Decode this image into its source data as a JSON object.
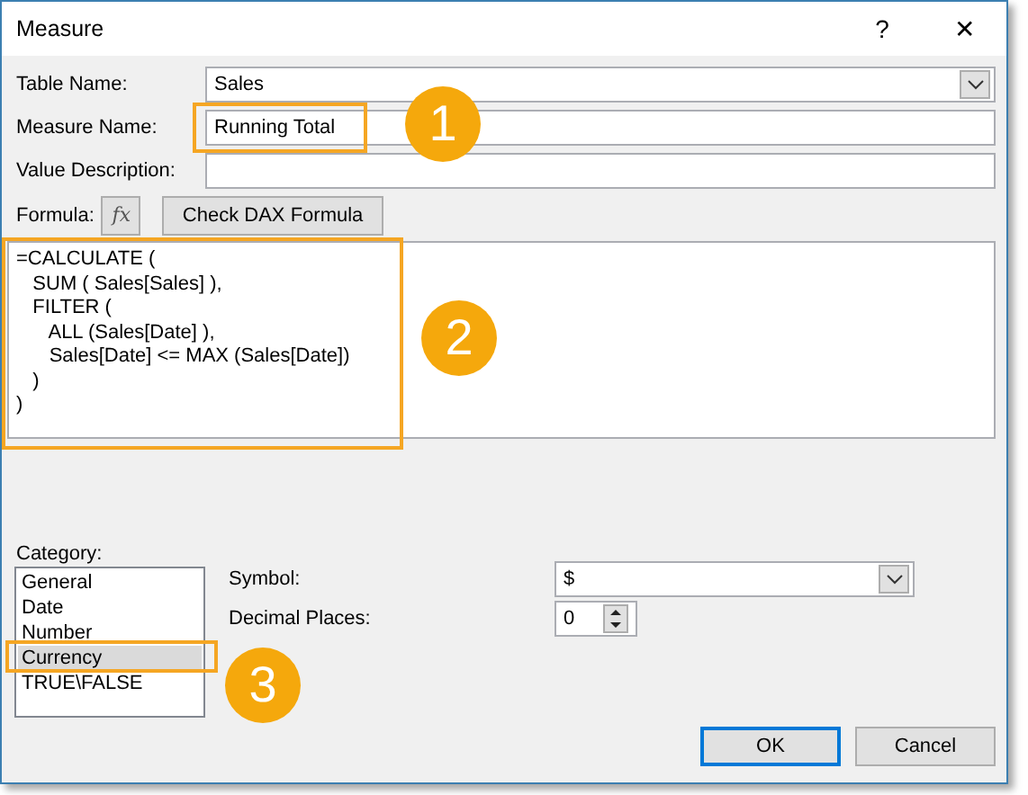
{
  "window": {
    "title": "Measure",
    "help": "?",
    "close": "✕"
  },
  "fields": [
    {
      "kind": "select",
      "label": "Table Name:",
      "value": "Sales"
    },
    {
      "kind": "text",
      "label": "Measure Name:",
      "value": "Running Total"
    },
    {
      "kind": "text",
      "label": "Value Description:"
    }
  ],
  "formula": {
    "label": "Formula:",
    "fx": "fx",
    "check_button": "Check DAX Formula",
    "lines": [
      "=CALCULATE (",
      "   SUM ( Sales[Sales] ),",
      "   FILTER (",
      "      ALL (Sales[Date] ),",
      "      Sales[Date] <= MAX (Sales[Date])",
      "   )",
      ")"
    ]
  },
  "category": {
    "label": "Category:",
    "items": [
      {
        "label": "General",
        "selected": false
      },
      {
        "label": "Date",
        "selected": false
      },
      {
        "label": "Number",
        "selected": false
      },
      {
        "label": "Currency",
        "selected": true
      },
      {
        "label": "TRUE\\FALSE",
        "selected": false
      }
    ]
  },
  "options": [
    {
      "kind": "select",
      "label": "Symbol:",
      "value": "$"
    },
    {
      "kind": "spin",
      "label": "Decimal Places:",
      "value": "0"
    }
  ],
  "buttons": [
    {
      "label": "OK",
      "default": true
    },
    {
      "label": "Cancel",
      "default": false
    }
  ],
  "callouts": [
    {
      "label": "1"
    },
    {
      "label": "2"
    },
    {
      "label": "3"
    }
  ]
}
